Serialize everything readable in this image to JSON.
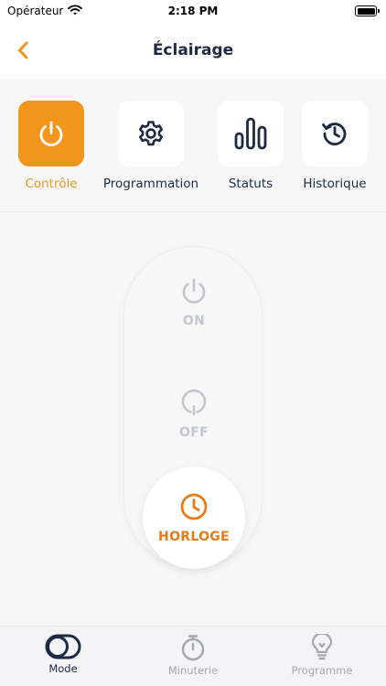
{
  "status_bar": {
    "carrier": "Opérateur",
    "time": "2:18 PM"
  },
  "header": {
    "title": "Éclairage"
  },
  "tabs": [
    {
      "label": "Contrôle",
      "icon": "power-icon",
      "active": true
    },
    {
      "label": "Programmation",
      "icon": "gear-icon",
      "active": false
    },
    {
      "label": "Statuts",
      "icon": "bar-chart-icon",
      "active": false
    },
    {
      "label": "Historique",
      "icon": "history-icon",
      "active": false
    }
  ],
  "modes": [
    {
      "label": "ON",
      "icon": "power-icon",
      "selected": false
    },
    {
      "label": "OFF",
      "icon": "power-off-icon",
      "selected": false
    },
    {
      "label": "HORLOGE",
      "icon": "clock-icon",
      "selected": true
    }
  ],
  "bottom_tabs": [
    {
      "label": "Mode",
      "icon": "toggle-icon",
      "active": true
    },
    {
      "label": "Minuterie",
      "icon": "stopwatch-icon",
      "active": false
    },
    {
      "label": "Programme",
      "icon": "lightbulb-icon",
      "active": false
    }
  ],
  "colors": {
    "accent": "#f2951c",
    "selected_mode": "#ea7a16",
    "navy": "#1d2a44",
    "inactive": "#c3c6cc"
  }
}
